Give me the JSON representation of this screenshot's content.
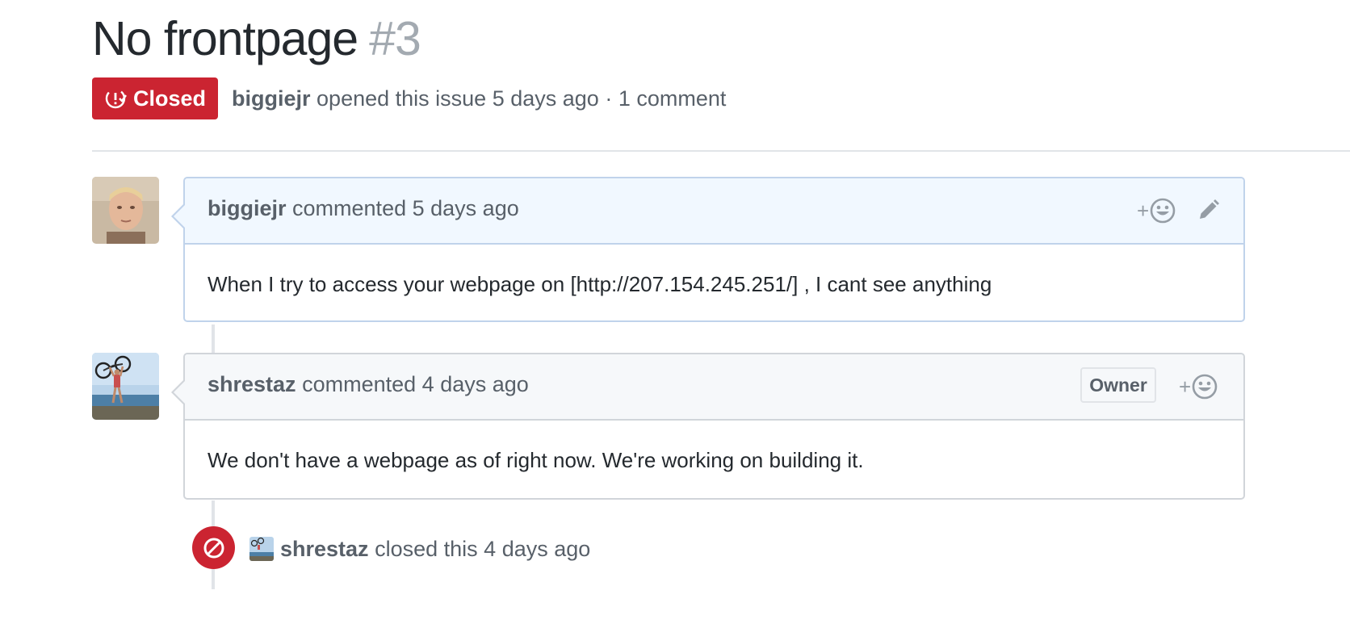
{
  "issue": {
    "title": "No frontpage",
    "number": "#3",
    "state": "Closed",
    "state_color": "#cb2431",
    "author": "biggiejr",
    "opened_text": "opened this issue",
    "opened_time": "5 days ago",
    "separator": "·",
    "comment_count": "1 comment"
  },
  "comments": [
    {
      "author": "biggiejr",
      "action": "commented",
      "time": "5 days ago",
      "body": "When I try to access your webpage on [http://207.154.245.251/] , I cant see anything",
      "react_plus": "+",
      "avatar_icon": "avatar-photo-biggiejr",
      "actions": [
        "add-reaction-icon",
        "pencil-icon"
      ]
    },
    {
      "author": "shrestaz",
      "action": "commented",
      "time": "4 days ago",
      "badge": "Owner",
      "body": "We don't have a webpage as of right now. We're working on building it.",
      "react_plus": "+",
      "avatar_icon": "avatar-photo-shrestaz",
      "actions": [
        "add-reaction-icon"
      ]
    }
  ],
  "event": {
    "icon": "circle-slash-icon",
    "actor": "shrestaz",
    "action": "closed this",
    "time": "4 days ago"
  }
}
